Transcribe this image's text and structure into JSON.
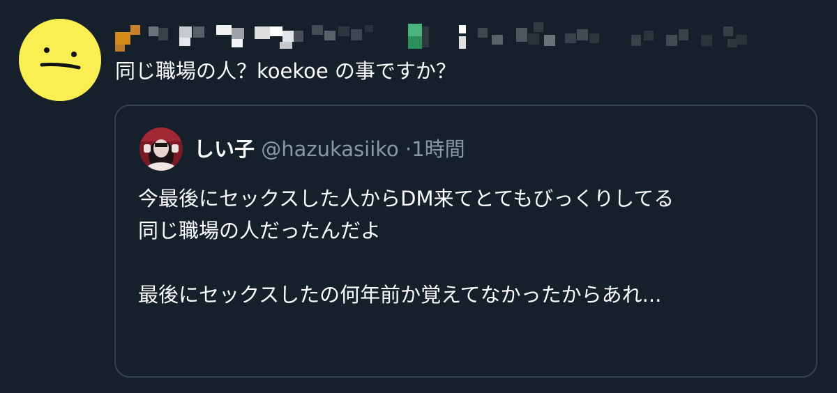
{
  "tweet": {
    "author_avatar_icon": "neutral-face-icon",
    "author_avatar_color": "#f9ef52",
    "author_name_censored": true,
    "text": "同じ職場の人？koekoe の事ですか？"
  },
  "quote": {
    "avatar_icon": "user-photo-avatar",
    "name": "しい子",
    "handle": "@hazukasiiko",
    "separator": "·",
    "time": "1時間",
    "text": "今最後にセックスした人からDM来てとてもびっくりしてる\n同じ職場の人だったんだよ\n\n最後にセックスしたの何年前か覚えてなかったからあれ..."
  },
  "colors": {
    "background": "#15202b",
    "card_border": "#38444d",
    "secondary_text": "#8899a6",
    "primary_text": "#ffffff"
  }
}
